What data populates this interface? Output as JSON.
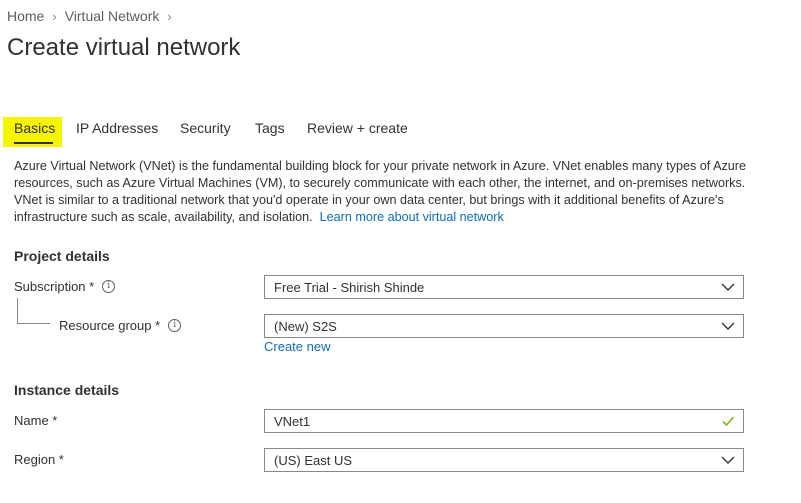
{
  "breadcrumb": {
    "items": [
      "Home",
      "Virtual Network"
    ]
  },
  "page": {
    "title": "Create virtual network"
  },
  "tabs": [
    {
      "label": "Basics",
      "active": true
    },
    {
      "label": "IP Addresses"
    },
    {
      "label": "Security"
    },
    {
      "label": "Tags"
    },
    {
      "label": "Review + create"
    }
  ],
  "description": {
    "text": "Azure Virtual Network (VNet) is the fundamental building block for your private network in Azure. VNet enables many types of Azure resources, such as Azure Virtual Machines (VM), to securely communicate with each other, the internet, and on-premises networks. VNet is similar to a traditional network that you'd operate in your own data center, but brings with it additional benefits of Azure's infrastructure such as scale, availability, and isolation.",
    "link": "Learn more about virtual network"
  },
  "project": {
    "heading": "Project details",
    "subscription_label": "Subscription *",
    "subscription_value": "Free Trial - Shirish Shinde",
    "resource_group_label": "Resource group *",
    "resource_group_value": "(New) S2S",
    "create_new": "Create new"
  },
  "instance": {
    "heading": "Instance details",
    "name_label": "Name *",
    "name_value": "VNet1",
    "region_label": "Region *",
    "region_value": "(US) East US"
  },
  "colors": {
    "link": "#0f6cbd",
    "highlight": "#f6f500",
    "valid_check": "#6bb700"
  },
  "icons": {
    "info": "info-icon",
    "chevron": "chevron-down-icon",
    "check": "checkmark-icon"
  }
}
